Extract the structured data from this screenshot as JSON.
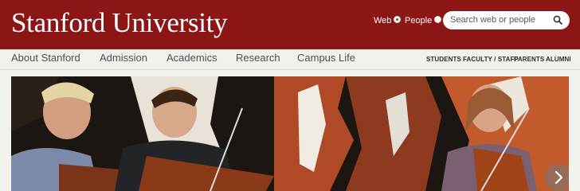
{
  "header": {
    "logo_text": "Stanford University",
    "search_scope": {
      "options": [
        {
          "label": "Web",
          "checked": true
        },
        {
          "label": "People",
          "checked": false
        }
      ]
    },
    "search": {
      "placeholder": "Search web or people",
      "icon": "search-icon"
    }
  },
  "nav": {
    "main_items": [
      "About Stanford",
      "Admission",
      "Academics",
      "Research",
      "Campus Life"
    ],
    "utility_items": [
      "STUDENTS",
      "FACULTY / STAFF",
      "PARENTS",
      "ALUMNI"
    ]
  },
  "hero": {
    "next_icon": "chevron-right-icon"
  },
  "colors": {
    "brand": "#8c1515",
    "nav_background": "#f2f1eb",
    "nav_text": "#4d4f53"
  }
}
